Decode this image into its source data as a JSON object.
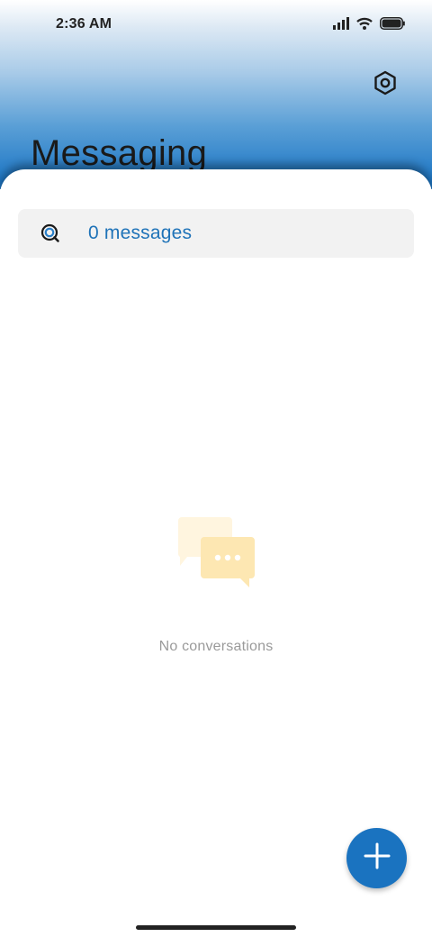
{
  "status_bar": {
    "time": "2:36 AM",
    "icons": [
      "cellular-signal-icon",
      "wifi-icon",
      "battery-icon"
    ]
  },
  "header": {
    "title": "Messaging",
    "settings_icon": "settings-hexagon-icon"
  },
  "search": {
    "icon": "search-icon",
    "label": "0 messages"
  },
  "empty_state": {
    "icon": "chat-bubbles-icon",
    "text": "No conversations"
  },
  "fab": {
    "icon": "plus-icon"
  },
  "colors": {
    "accent": "#1a73c0",
    "header_gradient_end": "#1c74c2",
    "search_text": "#1f73b8",
    "empty_text": "#9a9a9a",
    "illustration": "#fde7b2"
  }
}
